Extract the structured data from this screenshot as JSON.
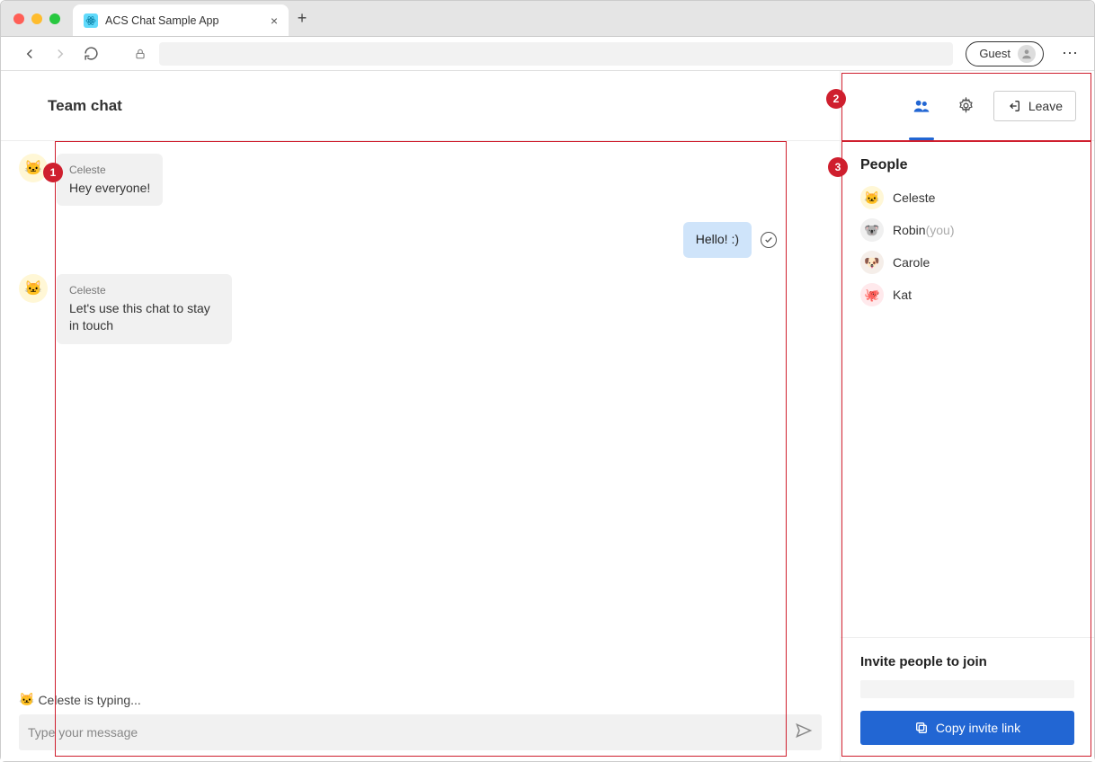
{
  "browser": {
    "tab_title": "ACS Chat Sample App",
    "guest_label": "Guest"
  },
  "chat": {
    "header_title": "Team chat",
    "messages": [
      {
        "sender": "Celeste",
        "body": "Hey everyone!"
      },
      {
        "sender": "Celeste",
        "body": "Let's use this chat to stay in touch"
      }
    ],
    "my_message": "Hello! :)",
    "typing_indicator": "Celeste is typing...",
    "compose_placeholder": "Type your message"
  },
  "side": {
    "leave_label": "Leave",
    "people_heading": "People",
    "people": [
      {
        "name": "Celeste",
        "emoji": "🐱",
        "cls": "c1",
        "you": false
      },
      {
        "name": "Robin",
        "emoji": "🐨",
        "cls": "c2",
        "you": true
      },
      {
        "name": "Carole",
        "emoji": "🐶",
        "cls": "c3",
        "you": false
      },
      {
        "name": "Kat",
        "emoji": "🐙",
        "cls": "c4",
        "you": false
      }
    ],
    "you_suffix": "(you)",
    "invite_heading": "Invite people to join",
    "copy_label": "Copy invite link"
  },
  "annotations": {
    "n1": "1",
    "n2": "2",
    "n3": "3"
  }
}
